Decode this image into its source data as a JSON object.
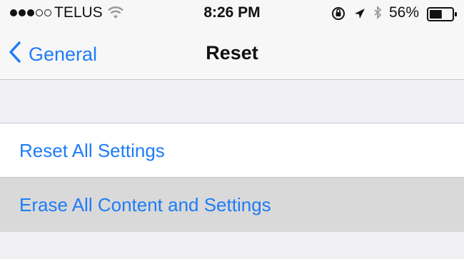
{
  "status_bar": {
    "carrier": "TELUS",
    "time": "8:26 PM",
    "battery_percent": "56%",
    "battery_level": 0.56,
    "signal_bars_filled": 3,
    "signal_bars_total": 5,
    "icons": [
      "wifi-icon",
      "orientation-lock-icon",
      "location-icon",
      "bluetooth-icon",
      "battery-icon"
    ]
  },
  "nav": {
    "back_label": "General",
    "title": "Reset"
  },
  "list": {
    "items": [
      {
        "label": "Reset All Settings",
        "state": "normal"
      },
      {
        "label": "Erase All Content and Settings",
        "state": "pressed"
      }
    ]
  },
  "colors": {
    "accent": "#1e7cf6",
    "background": "#efeff4",
    "pressed": "#d9d9d9"
  }
}
